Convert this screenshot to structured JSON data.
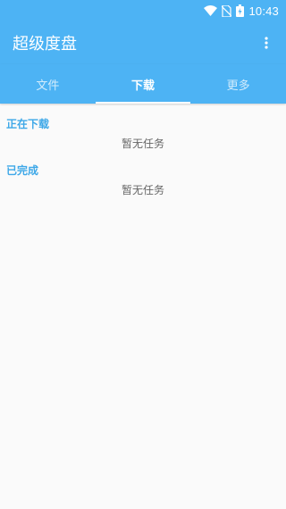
{
  "status_bar": {
    "time": "10:43",
    "icons": [
      "wifi-icon",
      "no-sim-icon",
      "battery-charging-icon"
    ]
  },
  "app_bar": {
    "title": "超级度盘",
    "menu_icon": "more-vert-icon"
  },
  "tabs": [
    {
      "label": "文件",
      "active": false
    },
    {
      "label": "下载",
      "active": true
    },
    {
      "label": "更多",
      "active": false
    }
  ],
  "sections": [
    {
      "header": "正在下载",
      "empty_text": "暂无任务"
    },
    {
      "header": "已完成",
      "empty_text": "暂无任务"
    }
  ],
  "colors": {
    "primary": "#4db3f4",
    "section_header": "#3ea8e8",
    "background": "#fafafa"
  }
}
